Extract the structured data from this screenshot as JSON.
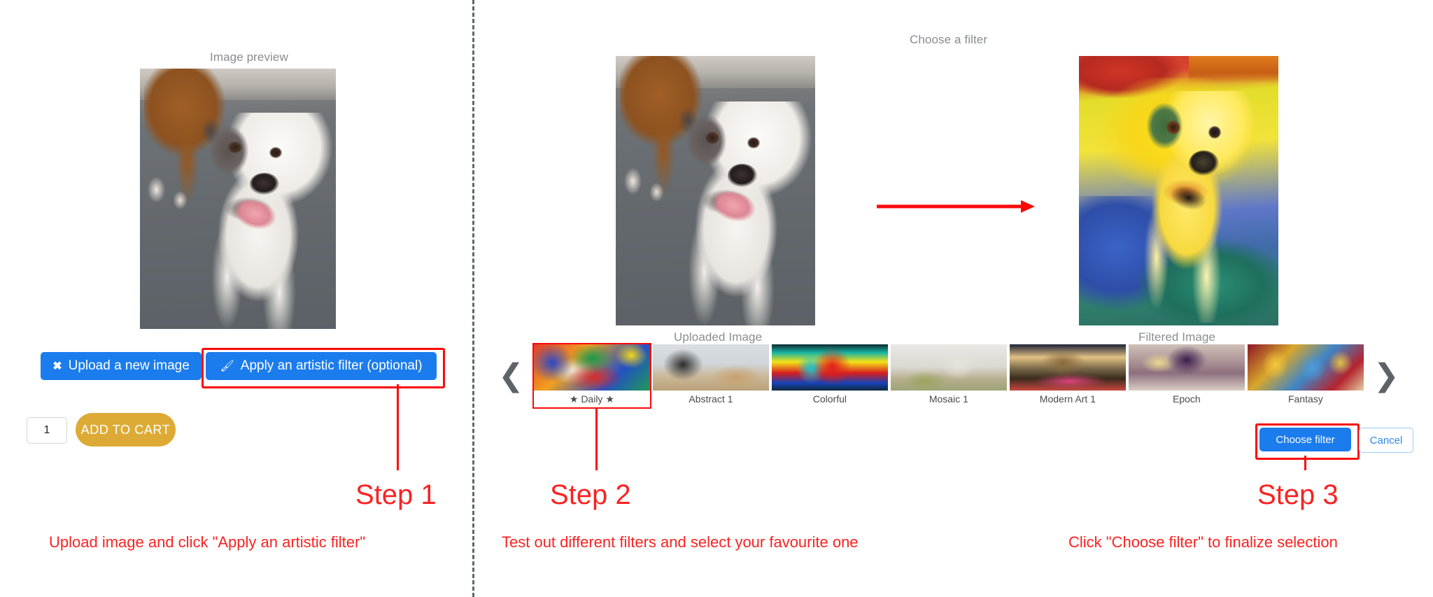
{
  "left_panel": {
    "preview_label": "Image preview",
    "upload_button": "Upload a new image",
    "upload_icon": "close-x-icon",
    "filter_button": "Apply an artistic filter (optional)",
    "filter_icon": "paintbrush-icon",
    "quantity_value": "1",
    "quantity_placeholder": "1",
    "add_to_cart_button": "ADD TO CART"
  },
  "right_panel": {
    "dialog_title": "Choose a filter",
    "uploaded_image_label": "Uploaded Image",
    "filtered_image_label": "Filtered Image",
    "transform_arrow_icon": "right-arrow-icon",
    "prev_icon": "chevron-left-icon",
    "next_icon": "chevron-right-icon",
    "filters": [
      {
        "name": "★ Daily ★",
        "art": "t-daily",
        "selected": true
      },
      {
        "name": "Abstract 1",
        "art": "t-abstract",
        "selected": false
      },
      {
        "name": "Colorful",
        "art": "t-colorful",
        "selected": false
      },
      {
        "name": "Mosaic 1",
        "art": "t-mosaic",
        "selected": false
      },
      {
        "name": "Modern Art 1",
        "art": "t-modern",
        "selected": false
      },
      {
        "name": "Epoch",
        "art": "t-epoch",
        "selected": false
      },
      {
        "name": "Fantasy",
        "art": "t-fantasy",
        "selected": false
      }
    ],
    "choose_filter_button": "Choose filter",
    "cancel_button": "Cancel"
  },
  "annotations": {
    "step1": {
      "title": "Step 1",
      "desc": "Upload image and click \"Apply an artistic filter\""
    },
    "step2": {
      "title": "Step 2",
      "desc": "Test out different filters and select your favourite one"
    },
    "step3": {
      "title": "Step 3",
      "desc": "Click \"Choose filter\" to finalize selection"
    }
  },
  "colors": {
    "annotation_red": "#fb0a0a",
    "primary_blue": "#1b7ced",
    "cart_gold": "#ddab35",
    "muted_gray": "#888d92"
  }
}
